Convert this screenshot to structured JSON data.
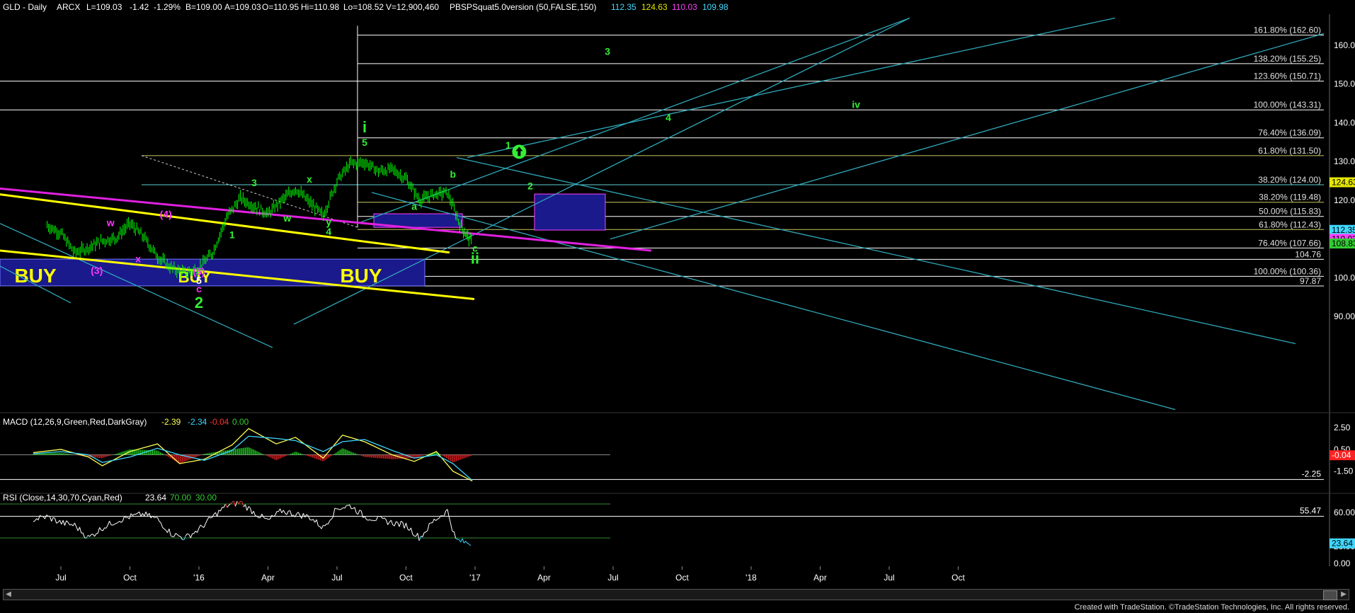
{
  "header": {
    "symbol": "GLD - Daily",
    "exchange": "ARCX",
    "last": "L=109.03",
    "change": "-1.42",
    "change_pct": "-1.29%",
    "bid": "B=109.00",
    "ask": "A=109.03",
    "open": "O=110.95",
    "high": "Hi=110.98",
    "low": "Lo=108.52",
    "volume": "V=12,900,460",
    "indicator": "PBSPSquat5.0version (50,FALSE,150)",
    "ind_vals": [
      "112.35",
      "124.63",
      "110.03",
      "109.98"
    ],
    "ind_colors": [
      "#3fd8ff",
      "#e6e600",
      "#ff40ff",
      "#3fd8ff"
    ]
  },
  "colors": {
    "background": "#000000",
    "price_bar": "#00ff00",
    "channel": "#2fa8b8",
    "fib_line": "#ffffff",
    "magenta_trend": "#e020e0",
    "yellow_trend": "#ffff00",
    "buy_box": "#1a1a8c",
    "buy_text": "#ffff00",
    "wave_green": "#33ee33",
    "wave_magenta": "#ff33ff",
    "macd_line": "#ffff55",
    "signal_line": "#3fd8ff",
    "rsi_line": "#ffffff",
    "rsi_low": "#3fd8ff",
    "rsi_high": "#ff3333"
  },
  "chart_data": [
    {
      "type": "line",
      "title": "GLD - Daily",
      "yticks": [
        90,
        100,
        110,
        120,
        130,
        140,
        150,
        160
      ],
      "ylim": [
        84,
        168
      ],
      "xticks": [
        "Jul",
        "Oct",
        "'16",
        "Apr",
        "Jul",
        "Oct",
        "'17",
        "Apr",
        "Jul",
        "Oct",
        "'18",
        "Apr",
        "Jul",
        "Oct"
      ],
      "x_months_start": "2015-05",
      "series": [
        {
          "values_monthly": [
            [
              2015.45,
              113.5
            ],
            [
              2015.5,
              111.5
            ],
            [
              2015.55,
              106.5
            ],
            [
              2015.6,
              107.8
            ],
            [
              2015.65,
              109.5
            ],
            [
              2015.7,
              110.3
            ],
            [
              2015.75,
              114.0
            ],
            [
              2015.8,
              110.5
            ],
            [
              2015.85,
              105.5
            ],
            [
              2015.9,
              102.5
            ],
            [
              2015.95,
              101.2
            ],
            [
              2016.0,
              102.5
            ],
            [
              2016.05,
              106.5
            ],
            [
              2016.1,
              115.5
            ],
            [
              2016.15,
              120.5
            ],
            [
              2016.2,
              118.5
            ],
            [
              2016.25,
              116.5
            ],
            [
              2016.3,
              120.0
            ],
            [
              2016.35,
              123.0
            ],
            [
              2016.4,
              119.5
            ],
            [
              2016.45,
              116.0
            ],
            [
              2016.5,
              125.0
            ],
            [
              2016.55,
              129.5
            ],
            [
              2016.6,
              129.8
            ],
            [
              2016.65,
              127.5
            ],
            [
              2016.7,
              128.0
            ],
            [
              2016.75,
              125.5
            ],
            [
              2016.8,
              120.0
            ],
            [
              2016.85,
              121.5
            ],
            [
              2016.9,
              122.0
            ],
            [
              2016.95,
              113.0
            ],
            [
              2016.99,
              109.03
            ]
          ]
        }
      ],
      "fib_levels": [
        {
          "label": "161.80% (162.60)",
          "value": 162.6
        },
        {
          "label": "138.20% (155.25)",
          "value": 155.25
        },
        {
          "label": "123.60% (150.71)",
          "value": 150.71
        },
        {
          "label": "100.00% (143.31)",
          "value": 143.31
        },
        {
          "label": "76.40% (136.09)",
          "value": 136.09
        },
        {
          "label": "61.80% (131.50)",
          "value": 131.5
        },
        {
          "label": "38.20% (124.00)",
          "value": 124.0
        },
        {
          "label": "38.20% (119.48)",
          "value": 119.48
        },
        {
          "label": "50.00% (115.83)",
          "value": 115.83
        },
        {
          "label": "61.80% (112.43)",
          "value": 112.43
        },
        {
          "label": "76.40% (107.66)",
          "value": 107.66
        },
        {
          "label": "104.76",
          "value": 104.76
        },
        {
          "label": "100.00% (100.36)",
          "value": 100.36
        },
        {
          "label": "97.87",
          "value": 97.87
        }
      ],
      "right_axis_markers": [
        {
          "label": "124.63",
          "value": 124.63,
          "color": "#e6e600"
        },
        {
          "label": "112.35",
          "value": 112.35,
          "color": "#3fd8ff"
        },
        {
          "label": "110.03",
          "value": 110.03,
          "color": "#ff40ff"
        },
        {
          "label": "108.83",
          "value": 108.83,
          "color": "#33cc33"
        }
      ],
      "wave_labels": [
        {
          "text": "(3)",
          "x": 2015.63,
          "y": 101.0,
          "color": "#ff33ff"
        },
        {
          "text": "w",
          "x": 2015.68,
          "y": 113.3,
          "color": "#ff33ff"
        },
        {
          "text": "x",
          "x": 2015.78,
          "y": 104.0,
          "color": "#ff33ff"
        },
        {
          "text": "(4)",
          "x": 2015.88,
          "y": 115.5,
          "color": "#ff33ff"
        },
        {
          "text": "(5)",
          "x": 2016.0,
          "y": 100.7,
          "color": "#ff33ff"
        },
        {
          "text": "5",
          "x": 2016.0,
          "y": 98.4,
          "color": "#ffffff"
        },
        {
          "text": "c",
          "x": 2016.0,
          "y": 96.2,
          "color": "#ff33ff"
        },
        {
          "text": "2",
          "x": 2016.0,
          "y": 92.2,
          "color": "#33ee33"
        },
        {
          "text": "1",
          "x": 2016.12,
          "y": 110.2,
          "color": "#33ee33"
        },
        {
          "text": "3",
          "x": 2016.2,
          "y": 123.6,
          "color": "#33ee33"
        },
        {
          "text": "w",
          "x": 2016.32,
          "y": 114.5,
          "color": "#33ee33"
        },
        {
          "text": "x",
          "x": 2016.4,
          "y": 124.5,
          "color": "#33ee33"
        },
        {
          "text": "y",
          "x": 2016.47,
          "y": 113.5,
          "color": "#33ee33"
        },
        {
          "text": "4",
          "x": 2016.47,
          "y": 111.0,
          "color": "#33ee33"
        },
        {
          "text": "5",
          "x": 2016.6,
          "y": 134.0,
          "color": "#33ee33"
        },
        {
          "text": "i",
          "x": 2016.6,
          "y": 137.5,
          "color": "#33ee33"
        },
        {
          "text": "a",
          "x": 2016.78,
          "y": 117.5,
          "color": "#33ee33"
        },
        {
          "text": "b",
          "x": 2016.92,
          "y": 125.8,
          "color": "#33ee33"
        },
        {
          "text": "c",
          "x": 2017.0,
          "y": 106.7,
          "color": "#33ee33"
        },
        {
          "text": "ii",
          "x": 2017.0,
          "y": 103.6,
          "color": "#33ee33"
        },
        {
          "text": "1",
          "x": 2017.12,
          "y": 133.3,
          "color": "#33ee33"
        },
        {
          "text": "2",
          "x": 2017.2,
          "y": 122.8,
          "color": "#33ee33"
        },
        {
          "text": "3",
          "x": 2017.48,
          "y": 157.5,
          "color": "#33ee33"
        },
        {
          "text": "4",
          "x": 2017.7,
          "y": 140.4,
          "color": "#33ee33"
        },
        {
          "text": "iv",
          "x": 2018.38,
          "y": 143.8,
          "color": "#33ee33"
        }
      ],
      "buy_labels": [
        "BUY",
        "BUY",
        "BUY"
      ]
    },
    {
      "type": "line",
      "title": "MACD (12,26,9,Green,Red,DarkGray)",
      "values": [
        "-2.39",
        "-2.34",
        "-0.04",
        "0.00"
      ],
      "value_colors": [
        "#ffff55",
        "#3fd8ff",
        "#ff3333",
        "#33cc33"
      ],
      "yticks": [
        "2.50",
        "0.50",
        "-1.50"
      ],
      "markers": [
        {
          "label": "-0.04",
          "color": "#ff2222"
        },
        {
          "label": "-2.25",
          "color": "#ffffff"
        }
      ],
      "series": [
        {
          "name": "MACD",
          "x": [
            2015.4,
            2015.5,
            2015.6,
            2015.65,
            2015.75,
            2015.85,
            2015.93,
            2016.02,
            2016.12,
            2016.18,
            2016.28,
            2016.35,
            2016.45,
            2016.52,
            2016.6,
            2016.7,
            2016.78,
            2016.86,
            2016.92,
            2016.99
          ],
          "y": [
            0.2,
            0.5,
            -0.2,
            -1.0,
            0.3,
            1.0,
            -0.8,
            -0.4,
            0.9,
            2.4,
            1.0,
            1.6,
            -0.3,
            1.8,
            1.2,
            0.0,
            -0.6,
            0.3,
            -1.5,
            -2.39
          ]
        },
        {
          "name": "Signal",
          "x": [
            2015.4,
            2015.5,
            2015.6,
            2015.65,
            2015.75,
            2015.85,
            2015.93,
            2016.02,
            2016.12,
            2016.18,
            2016.28,
            2016.35,
            2016.45,
            2016.52,
            2016.6,
            2016.7,
            2016.78,
            2016.86,
            2016.92,
            2016.99
          ],
          "y": [
            0.1,
            0.3,
            0.0,
            -0.7,
            -0.2,
            0.6,
            0.0,
            -0.5,
            0.4,
            1.7,
            1.5,
            1.3,
            0.3,
            1.2,
            1.4,
            0.4,
            -0.3,
            0.0,
            -0.8,
            -2.34
          ]
        }
      ]
    },
    {
      "type": "line",
      "title": "RSI (Close,14,30,70,Cyan,Red)",
      "values": [
        "23.64",
        "70.00",
        "30.00"
      ],
      "value_colors": [
        "#ffffff",
        "#33cc33",
        "#33cc33"
      ],
      "yticks": [
        "60.00",
        "20.00",
        "0.00"
      ],
      "markers": [
        {
          "label": "55.47",
          "color": "#ffffff"
        },
        {
          "label": "23.64",
          "color": "#3fd8ff"
        }
      ],
      "series": [
        {
          "name": "RSI",
          "x": [
            2015.4,
            2015.45,
            2015.5,
            2015.55,
            2015.6,
            2015.65,
            2015.7,
            2015.75,
            2015.8,
            2015.85,
            2015.9,
            2015.95,
            2016.0,
            2016.05,
            2016.1,
            2016.15,
            2016.2,
            2016.25,
            2016.3,
            2016.35,
            2016.4,
            2016.45,
            2016.5,
            2016.55,
            2016.6,
            2016.65,
            2016.7,
            2016.75,
            2016.8,
            2016.85,
            2016.9,
            2016.93,
            2016.96,
            2016.99
          ],
          "y": [
            52,
            55,
            48,
            45,
            30,
            42,
            50,
            55,
            58,
            52,
            35,
            30,
            40,
            55,
            68,
            72,
            60,
            50,
            62,
            58,
            55,
            42,
            65,
            68,
            55,
            52,
            48,
            45,
            30,
            50,
            62,
            28,
            25,
            23.64
          ]
        }
      ]
    }
  ],
  "footer": {
    "credit": "Created with TradeStation. ©TradeStation Technologies, Inc. All rights reserved."
  }
}
